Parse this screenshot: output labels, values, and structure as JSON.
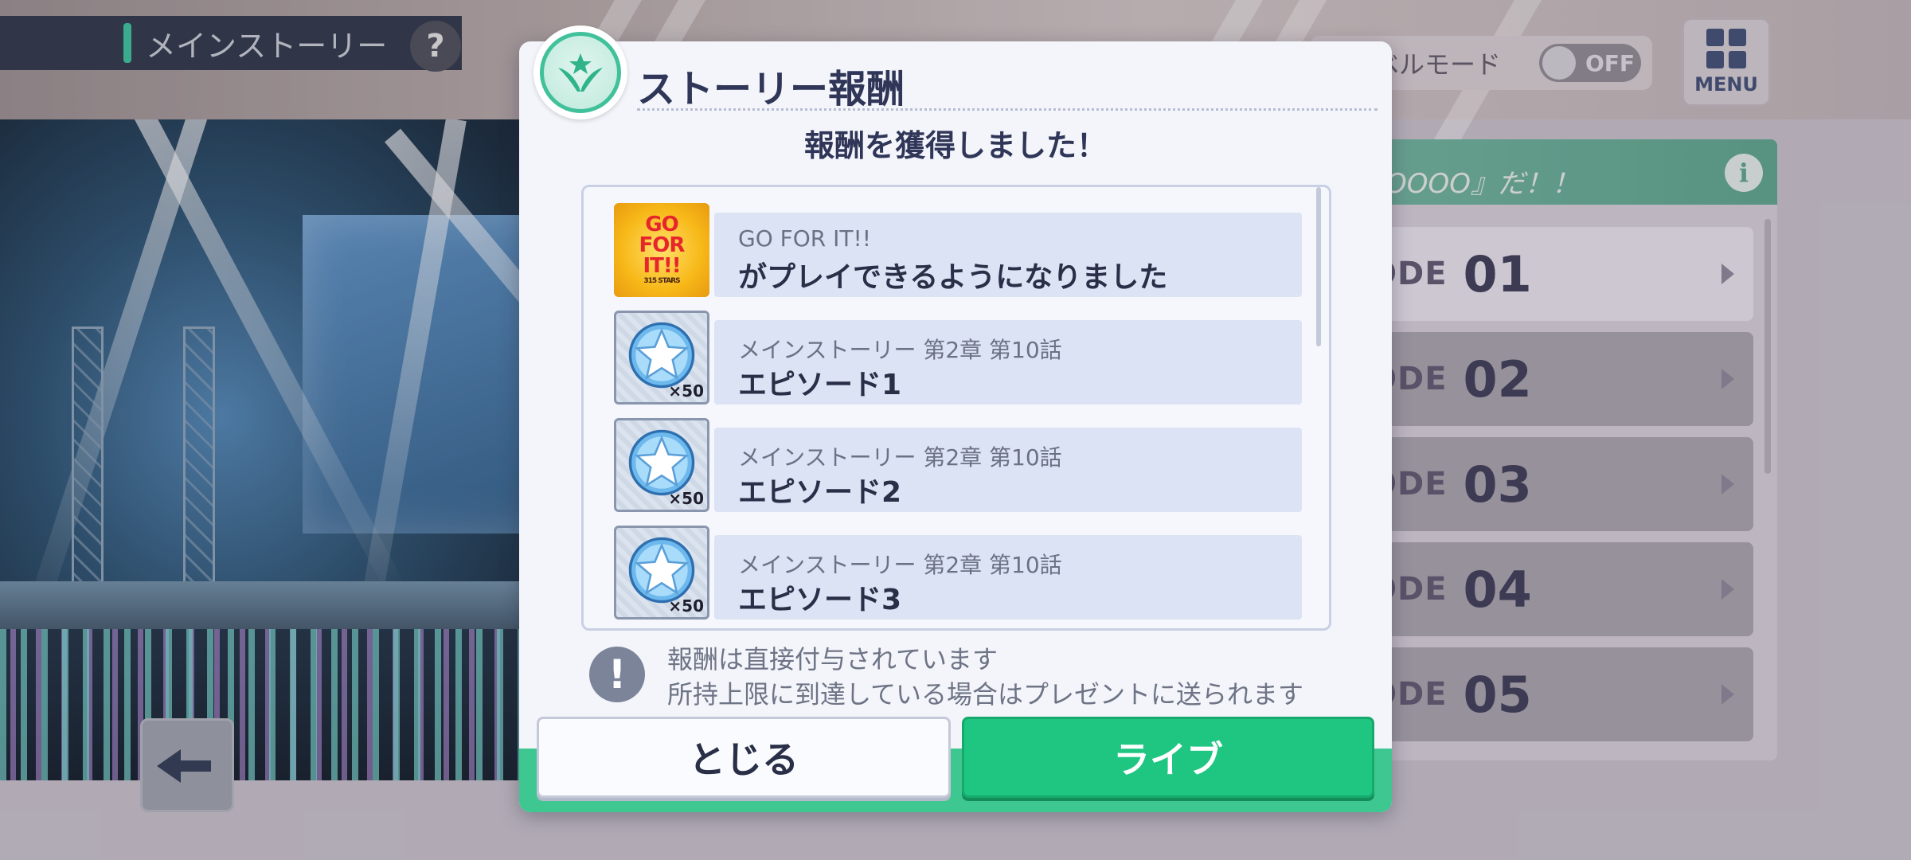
{
  "header": {
    "story_title": "メインストーリー",
    "help_label": "?",
    "level_mode_label": "ベルモード",
    "level_mode_toggle": "OFF",
    "menu_label": "MENU"
  },
  "chapter_panel": {
    "header_text": "OOOO』だ！！",
    "info_label": "i",
    "episodes": [
      {
        "label": "ODE",
        "number": "01"
      },
      {
        "label": "ODE",
        "number": "02"
      },
      {
        "label": "ODE",
        "number": "03"
      },
      {
        "label": "ODE",
        "number": "04"
      },
      {
        "label": "ODE",
        "number": "05"
      }
    ]
  },
  "modal": {
    "title": "ストーリー報酬",
    "subtitle": "報酬を獲得しました！",
    "rewards": [
      {
        "type": "song",
        "thumb_lines": [
          "GO",
          "FOR",
          "IT!!",
          "315 STARS"
        ],
        "line1": "GO FOR IT!!",
        "line2": "がプレイできるようになりました"
      },
      {
        "type": "gem",
        "count": "×50",
        "line1": "メインストーリー 第2章 第10話",
        "line2": "エピソード1"
      },
      {
        "type": "gem",
        "count": "×50",
        "line1": "メインストーリー 第2章 第10話",
        "line2": "エピソード2"
      },
      {
        "type": "gem",
        "count": "×50",
        "line1": "メインストーリー 第2章 第10話",
        "line2": "エピソード3"
      }
    ],
    "notice_icon_label": "!",
    "notice_lines": [
      "報酬は直接付与されています",
      "所持上限に到達している場合はプレゼントに送られます"
    ],
    "close_label": "とじる",
    "live_label": "ライブ"
  },
  "colors": {
    "accent_green": "#1fc682",
    "title_navy": "#2f3657"
  },
  "icons": [
    "help-icon",
    "menu-grid-icon",
    "back-arrow-icon",
    "info-icon",
    "emblem-icon",
    "gem-icon",
    "notice-icon"
  ]
}
